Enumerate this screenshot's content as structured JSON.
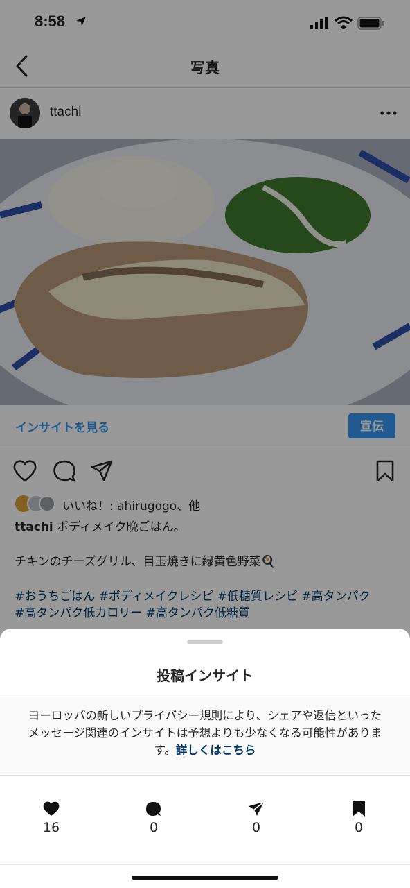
{
  "status": {
    "time": "8:58"
  },
  "nav": {
    "title": "写真"
  },
  "post": {
    "username": "ttachi",
    "insight_link": "インサイトを見る",
    "promote_label": "宣伝",
    "likes_text": "いいね！: ahirugogo、他",
    "caption_user": "ttachi",
    "caption_line1": "ボディメイク晩ごはん。",
    "caption_line2": "チキンのチーズグリル、目玉焼きに緑黄色野菜🍳",
    "hashtags_line1": "#おうちごはん #ボディメイクレシピ #低糖質レシピ #高タンパク",
    "hashtags_line2": "#高タンパク低カロリー #高タンパク低糖質"
  },
  "sheet": {
    "title": "投稿インサイト",
    "notice": "ヨーロッパの新しいプライバシー規則により、シェアや返信といったメッセージ関連のインサイトは予想よりも少なくなる可能性があります。",
    "notice_link": "詳しくはこちら",
    "stats": [
      {
        "icon": "heart-icon",
        "value": "16"
      },
      {
        "icon": "comment-icon",
        "value": "0"
      },
      {
        "icon": "share-icon",
        "value": "0"
      },
      {
        "icon": "bookmark-icon",
        "value": "0"
      }
    ]
  },
  "colors": {
    "link": "#3897f0",
    "hashtag": "#00376b"
  }
}
